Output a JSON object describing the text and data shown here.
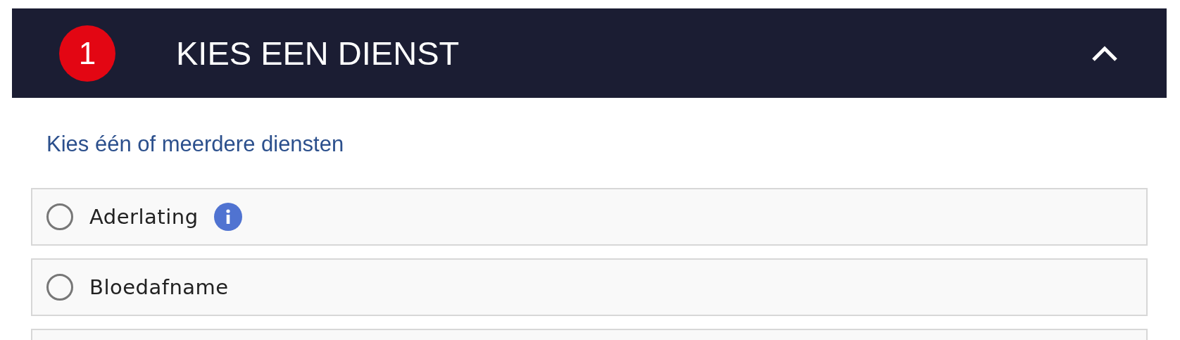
{
  "step": {
    "number": "1",
    "title": "KIES EEN DIENST",
    "expanded": true
  },
  "instruction": "Kies één of meerdere diensten",
  "services": [
    {
      "label": "Aderlating",
      "selected": false,
      "info": true
    },
    {
      "label": "Bloedafname",
      "selected": false,
      "info": false
    }
  ]
}
